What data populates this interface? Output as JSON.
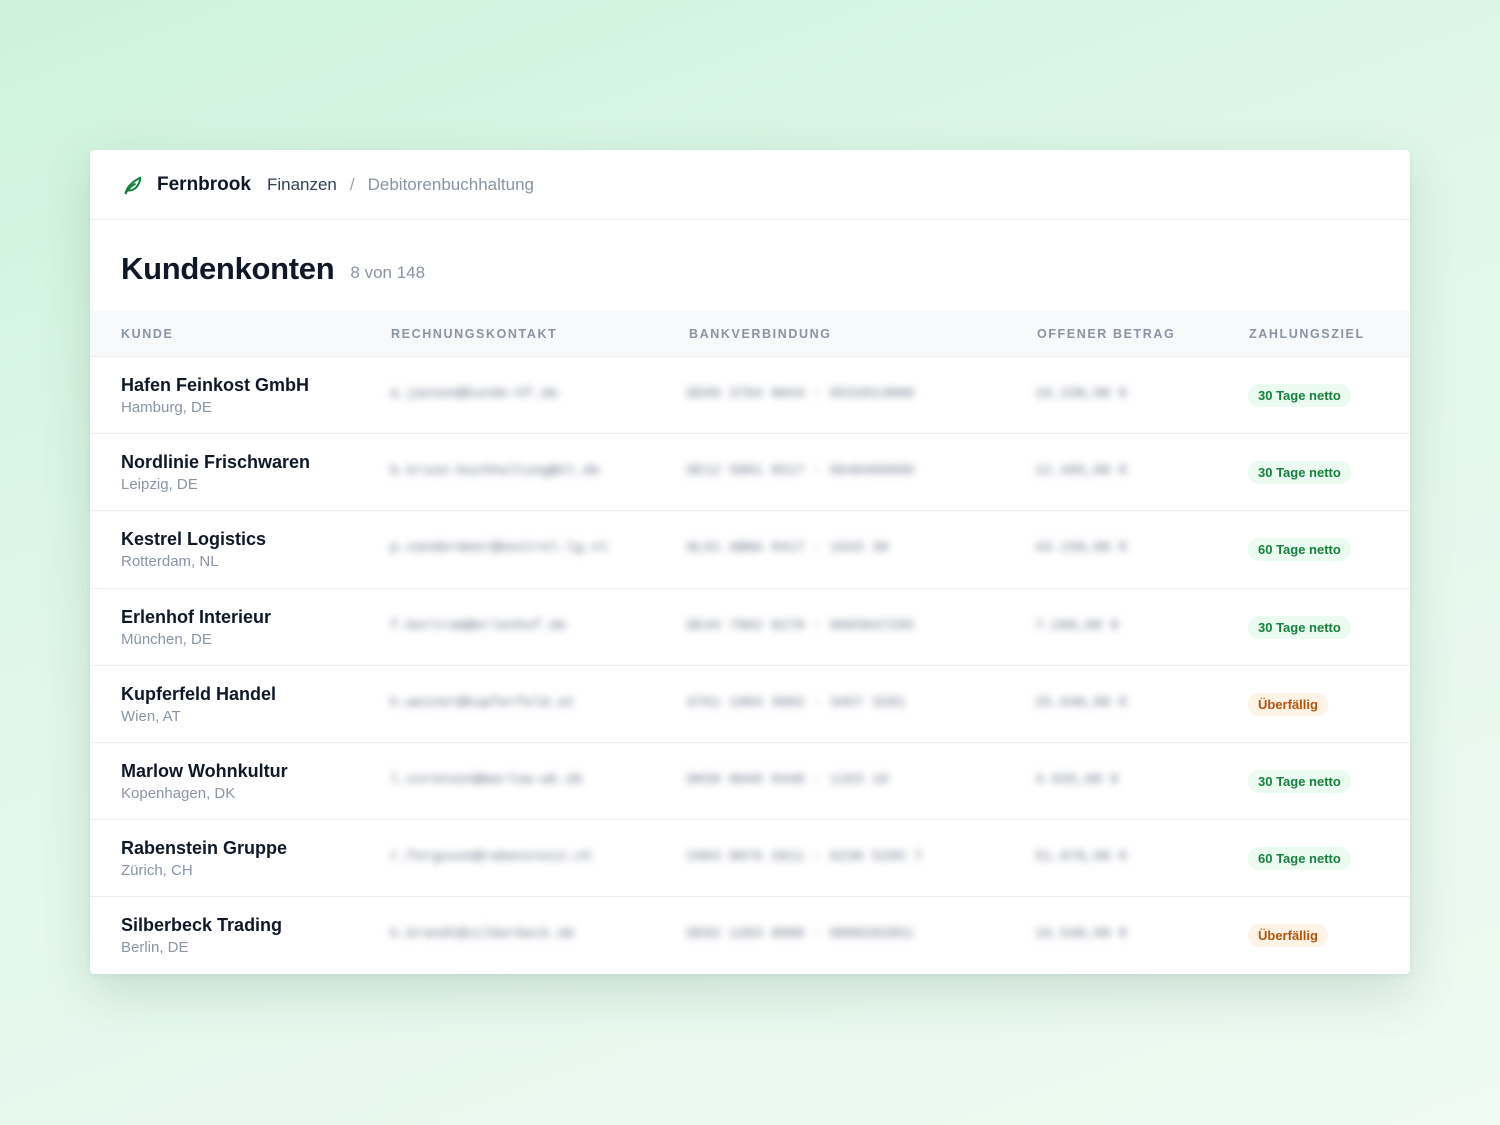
{
  "header": {
    "brand": "Fernbrook",
    "breadcrumb": [
      "Finanzen",
      "Debitorenbuchhaltung"
    ],
    "separator": "/",
    "logo_icon": "leaf-icon",
    "accent_color": "#17803d"
  },
  "page": {
    "title": "Kundenkonten",
    "count": "8 von 148"
  },
  "table": {
    "columns": [
      "KUNDE",
      "RECHNUNGSKONTAKT",
      "BANKVERBINDUNG",
      "OFFENER BETRAG",
      "ZAHLUNGSZIEL"
    ],
    "rows": [
      {
        "name": "Hafen Feinkost GmbH",
        "location": "Hamburg, DE",
        "contact": "a.jansen@kunde-hf.de",
        "bank": "DE89 3704 0044 · 0532013000",
        "amount": "18.230,00 €",
        "terms": "30 Tage netto",
        "status": "ok"
      },
      {
        "name": "Nordlinie Frischwaren",
        "location": "Leipzig, DE",
        "contact": "b.kruse-buchhaltung@nl.de",
        "bank": "DE12 5001 0517 · 0648489890",
        "amount": "12.495,00 €",
        "terms": "30 Tage netto",
        "status": "ok"
      },
      {
        "name": "Kestrel Logistics",
        "location": "Rotterdam, NL",
        "contact": "p.vandermeer@kestrel-lg.nl",
        "bank": "NL91 ABNA 0417 · 1643 38",
        "amount": "43.150,00 €",
        "terms": "60 Tage netto",
        "status": "ok"
      },
      {
        "name": "Erlenhof Interieur",
        "location": "München, DE",
        "contact": "f.bertram@erlenhof.de",
        "bank": "DE44 7002 0270 · 0665847295",
        "amount": "7.280,00 €",
        "terms": "30 Tage netto",
        "status": "ok"
      },
      {
        "name": "Kupferfeld Handel",
        "location": "Wien, AT",
        "contact": "h.weiner@kupferfeld.at",
        "bank": "AT61 1904 3002 · 3457 3201",
        "amount": "25.640,00 €",
        "terms": "Überfällig",
        "status": "late"
      },
      {
        "name": "Marlow Wohnkultur",
        "location": "Kopenhagen, DK",
        "contact": "l.sorensen@marlow-wk.dk",
        "bank": "DK50 0040 0440 · 1163 16",
        "amount": "4.935,00 €",
        "terms": "30 Tage netto",
        "status": "ok"
      },
      {
        "name": "Rabenstein Gruppe",
        "location": "Zürich, CH",
        "contact": "r.ferguson@rabenstein.ch",
        "bank": "CH93 0076 2011 · 6238 5295 7",
        "amount": "51.870,00 €",
        "terms": "60 Tage netto",
        "status": "ok"
      },
      {
        "name": "Silberbeck Trading",
        "location": "Berlin, DE",
        "contact": "k.brandt@silberbeck.de",
        "bank": "DE02 1203 0000 · 0000202051",
        "amount": "16.540,00 €",
        "terms": "Überfällig",
        "status": "late"
      }
    ]
  },
  "colors": {
    "badge_ok_bg": "#ecfbf1",
    "badge_ok_text": "#17803d",
    "badge_late_bg": "#fef4e6",
    "badge_late_text": "#b45309"
  }
}
